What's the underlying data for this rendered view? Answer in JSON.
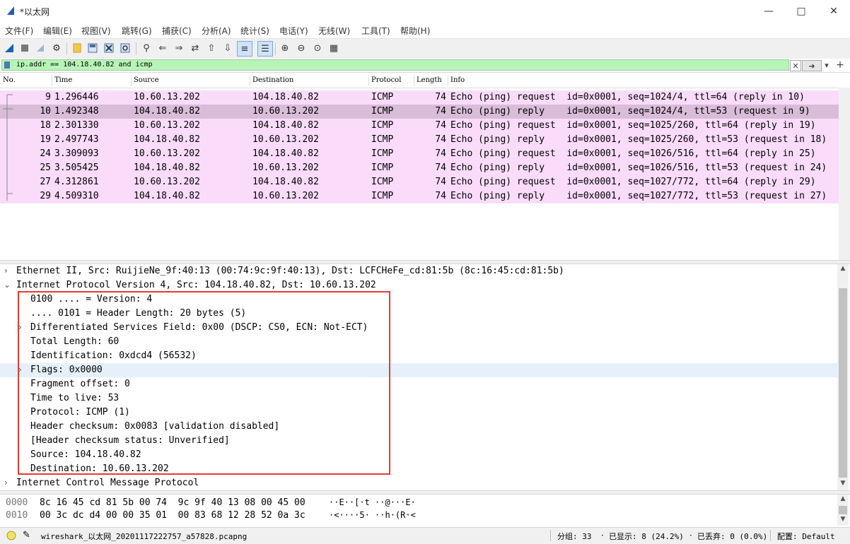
{
  "window": {
    "title": "*以太网",
    "min_icon": "minimize-icon",
    "max_icon": "maximize-icon",
    "close_icon": "close-icon"
  },
  "menu": [
    "文件(F)",
    "编辑(E)",
    "视图(V)",
    "跳转(G)",
    "捕获(C)",
    "分析(A)",
    "统计(S)",
    "电话(Y)",
    "无线(W)",
    "工具(T)",
    "帮助(H)"
  ],
  "toolbar": {
    "icons": [
      "shark-fin-start-icon",
      "stop-icon",
      "restart-icon",
      "capture-options-icon",
      "open-file-icon",
      "save-file-icon",
      "close-file-icon",
      "reload-icon",
      "find-icon",
      "back-icon",
      "forward-icon",
      "go-to-packet-icon",
      "first-packet-icon",
      "last-packet-icon",
      "autoscroll-icon",
      "colorize-icon",
      "zoom-in-icon",
      "zoom-out-icon",
      "normal-size-icon",
      "resize-columns-icon"
    ]
  },
  "filter": {
    "value": "ip.addr == 104.18.40.82 and icmp",
    "clear_icon": "clear-filter-icon",
    "apply_icon": "apply-filter-arrow-icon",
    "dropdown_icon": "chevron-down-icon",
    "add_icon": "plus-icon"
  },
  "packet_list": {
    "columns": [
      "No.",
      "Time",
      "Source",
      "Destination",
      "Protocol",
      "Length",
      "Info"
    ],
    "rows": [
      {
        "no": "9",
        "time": "1.296446",
        "src": "10.60.13.202",
        "dst": "104.18.40.82",
        "proto": "ICMP",
        "len": "74",
        "info": "Echo (ping) request  id=0x0001, seq=1024/4, ttl=64 (reply in 10)"
      },
      {
        "no": "10",
        "time": "1.492348",
        "src": "104.18.40.82",
        "dst": "10.60.13.202",
        "proto": "ICMP",
        "len": "74",
        "info": "Echo (ping) reply    id=0x0001, seq=1024/4, ttl=53 (request in 9)"
      },
      {
        "no": "18",
        "time": "2.301330",
        "src": "10.60.13.202",
        "dst": "104.18.40.82",
        "proto": "ICMP",
        "len": "74",
        "info": "Echo (ping) request  id=0x0001, seq=1025/260, ttl=64 (reply in 19)"
      },
      {
        "no": "19",
        "time": "2.497743",
        "src": "104.18.40.82",
        "dst": "10.60.13.202",
        "proto": "ICMP",
        "len": "74",
        "info": "Echo (ping) reply    id=0x0001, seq=1025/260, ttl=53 (request in 18)"
      },
      {
        "no": "24",
        "time": "3.309093",
        "src": "10.60.13.202",
        "dst": "104.18.40.82",
        "proto": "ICMP",
        "len": "74",
        "info": "Echo (ping) request  id=0x0001, seq=1026/516, ttl=64 (reply in 25)"
      },
      {
        "no": "25",
        "time": "3.505425",
        "src": "104.18.40.82",
        "dst": "10.60.13.202",
        "proto": "ICMP",
        "len": "74",
        "info": "Echo (ping) reply    id=0x0001, seq=1026/516, ttl=53 (request in 24)"
      },
      {
        "no": "27",
        "time": "4.312861",
        "src": "10.60.13.202",
        "dst": "104.18.40.82",
        "proto": "ICMP",
        "len": "74",
        "info": "Echo (ping) request  id=0x0001, seq=1027/772, ttl=64 (reply in 29)"
      },
      {
        "no": "29",
        "time": "4.509310",
        "src": "104.18.40.82",
        "dst": "10.60.13.202",
        "proto": "ICMP",
        "len": "74",
        "info": "Echo (ping) reply    id=0x0001, seq=1027/772, ttl=53 (request in 27)"
      }
    ],
    "selected_index": 1
  },
  "details": {
    "ethernet": "Ethernet II, Src: RuijieNe_9f:40:13 (00:74:9c:9f:40:13), Dst: LCFCHeFe_cd:81:5b (8c:16:45:cd:81:5b)",
    "ipv4": "Internet Protocol Version 4, Src: 104.18.40.82, Dst: 10.60.13.202",
    "ip_fields": [
      "0100 .... = Version: 4",
      ".... 0101 = Header Length: 20 bytes (5)",
      "Differentiated Services Field: 0x00 (DSCP: CS0, ECN: Not-ECT)",
      "Total Length: 60",
      "Identification: 0xdcd4 (56532)",
      "Flags: 0x0000",
      "Fragment offset: 0",
      "Time to live: 53",
      "Protocol: ICMP (1)",
      "Header checksum: 0x0083 [validation disabled]",
      "[Header checksum status: Unverified]",
      "Source: 104.18.40.82",
      "Destination: 10.60.13.202"
    ],
    "icmp": "Internet Control Message Protocol"
  },
  "bytes": [
    {
      "offset": "0000",
      "hex": "8c 16 45 cd 81 5b 00 74  9c 9f 40 13 08 00 45 00",
      "ascii": "··E··[·t ··@···E·"
    },
    {
      "offset": "0010",
      "hex": "00 3c dc d4 00 00 35 01  00 83 68 12 28 52 0a 3c",
      "ascii": "·<····5· ··h·(R·<"
    }
  ],
  "status": {
    "file": "wireshark_以太网_20201117222757_a57828.pcapng",
    "packets": "分组: 33",
    "displayed": "已显示: 8 (24.2%)",
    "dropped": "已丢弃: 0 (0.0%)",
    "profile": "配置: Default"
  },
  "colors": {
    "row_bg": "#fadcfa",
    "row_selected": "#d8bcd8",
    "filter_ok": "#b7f5b7",
    "highlight_box": "#e53935"
  }
}
